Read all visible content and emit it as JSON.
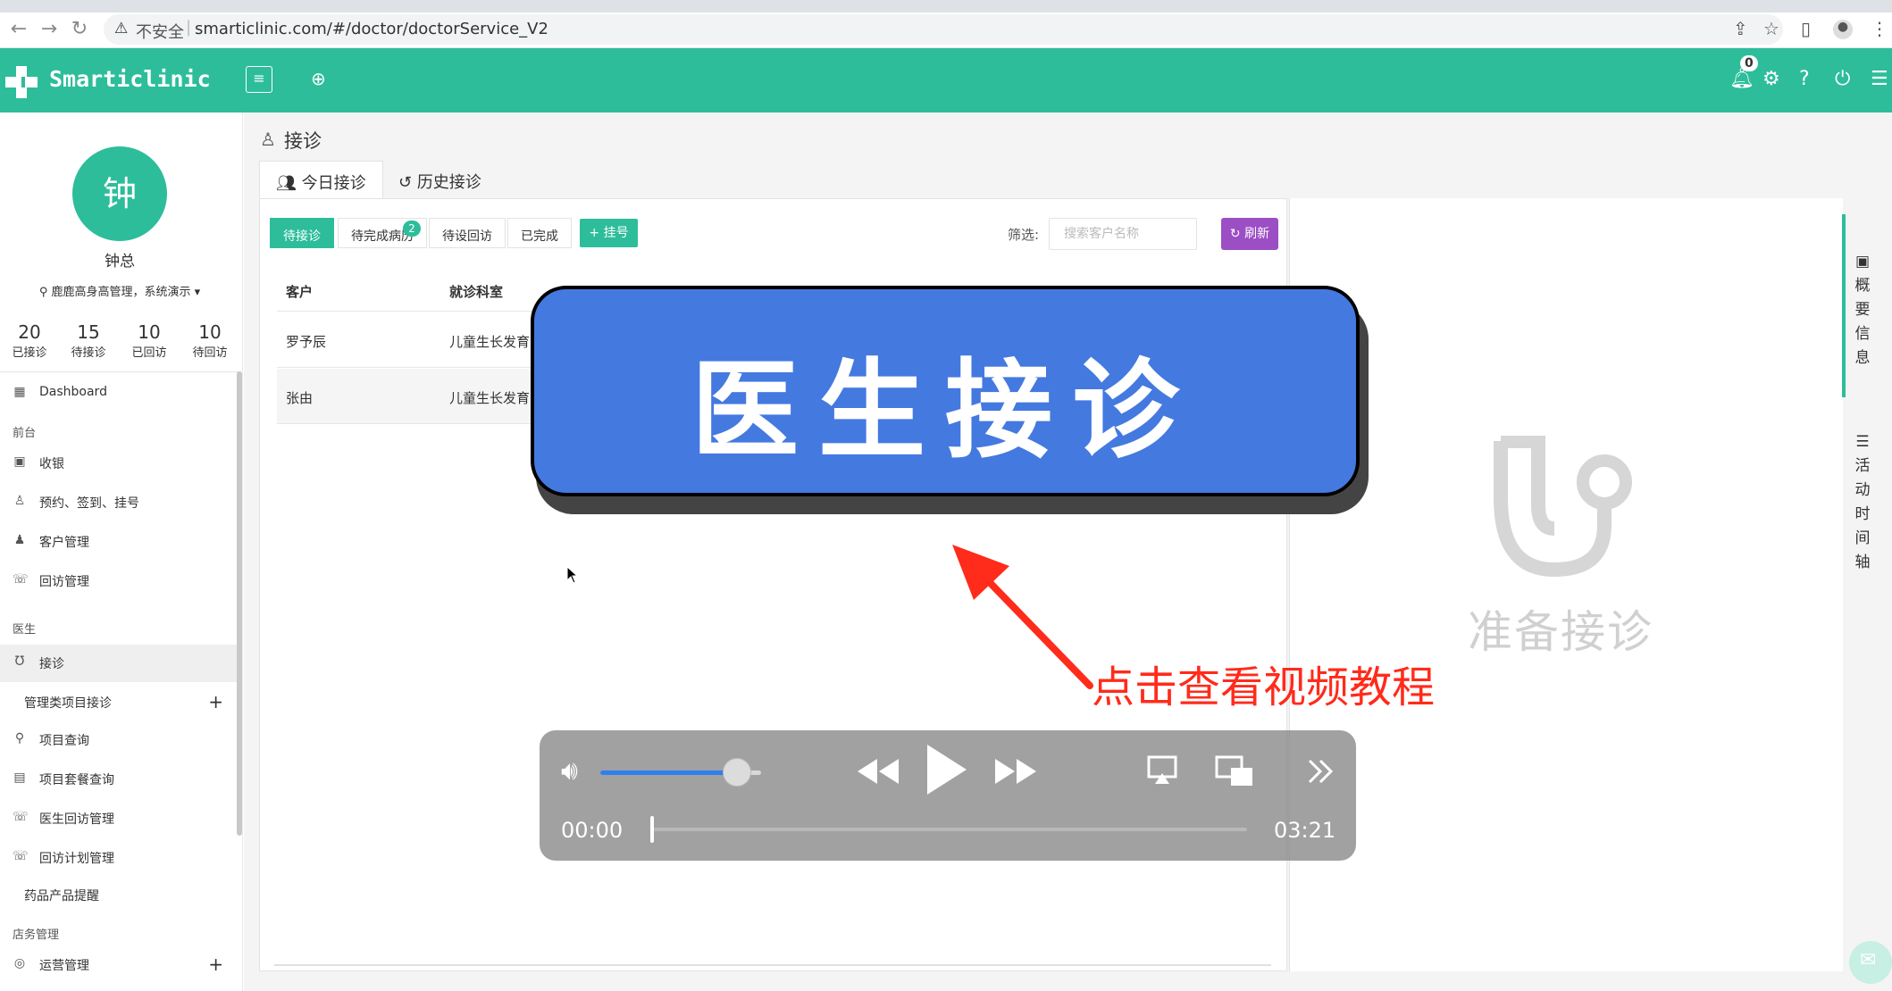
{
  "browser": {
    "insecure_label": "不安全",
    "url": "smarticlinic.com/#/doctor/doctorService_V2"
  },
  "header": {
    "app_name": "Smarticlinic",
    "notification_count": "0",
    "brand_color": "#2dbd9b"
  },
  "user": {
    "avatar_char": "钟",
    "name": "钟总",
    "store": "鹿鹿高身高管理，系统演示",
    "stats": [
      {
        "value": "20",
        "label": "已接诊"
      },
      {
        "value": "15",
        "label": "待接诊"
      },
      {
        "value": "10",
        "label": "已回访"
      },
      {
        "value": "10",
        "label": "待回访"
      }
    ]
  },
  "sidebar": {
    "dashboard": "Dashboard",
    "sec_front": "前台",
    "cashier": "收银",
    "appointment": "预约、签到、挂号",
    "customers": "客户管理",
    "followup": "回访管理",
    "sec_doctor": "医生",
    "consult": "接诊",
    "mgmt_consult": "管理类项目接诊",
    "item_query": "项目查询",
    "package_query": "项目套餐查询",
    "doctor_followup": "医生回访管理",
    "followup_plan": "回访计划管理",
    "drug_reminder": "药品产品提醒",
    "sec_store": "店务管理",
    "operations": "运营管理"
  },
  "page": {
    "title": "接诊",
    "tabs": [
      "今日接诊",
      "历史接诊"
    ],
    "subtabs": [
      "待接诊",
      "待完成病历",
      "待设回访",
      "已完成"
    ],
    "pending_record_badge": "2",
    "register_button": "+ 挂号",
    "filter_label": "筛选:",
    "search_placeholder": "搜索客户名称",
    "refresh_button": "刷新",
    "columns": [
      "客户",
      "就诊科室"
    ],
    "rows": [
      {
        "customer": "罗予辰",
        "department": "儿童生长发育"
      },
      {
        "customer": "张由",
        "department": "儿童生长发育"
      }
    ]
  },
  "right_panel": {
    "empty_text": "准备接诊",
    "vtab_overview": [
      "概",
      "要",
      "信",
      "息"
    ],
    "vtab_timeline": [
      "活",
      "动",
      "时",
      "间",
      "轴"
    ]
  },
  "overlay": {
    "banner_text": "医生接诊",
    "tutorial_text": "点击查看视频教程",
    "banner_color": "#4479e0",
    "tutorial_color": "#ff2b1b"
  },
  "player": {
    "current_time": "00:00",
    "total_time": "03:21",
    "volume_fraction": 0.85,
    "progress_fraction": 0
  }
}
